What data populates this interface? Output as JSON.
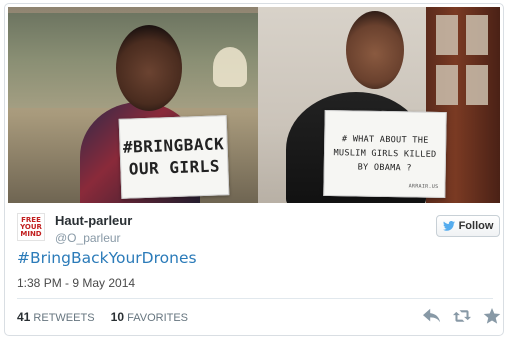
{
  "photo": {
    "sign_left_text": "#BRINGBACK OUR GIRLS",
    "sign_right_text": "# WHAT ABOUT THE MUSLIM GIRLS KILLED BY OBAMA ?",
    "sign_right_credit": "ARRAIR.US"
  },
  "avatar": {
    "line1": "FREE",
    "line2": "YOUR",
    "line3": "MIND"
  },
  "user": {
    "name": "Haut-parleur",
    "handle": "@O_parleur"
  },
  "follow_button": {
    "label": "Follow"
  },
  "tweet": {
    "text": "#BringBackYourDrones",
    "timestamp": "1:38 PM - 9 May 2014"
  },
  "stats": {
    "retweets_count": "41",
    "retweets_label": "RETWEETS",
    "favorites_count": "10",
    "favorites_label": "FAVORITES"
  },
  "colors": {
    "link": "#2b7bb9",
    "twitter_blue": "#55acee",
    "muted": "#8899a6"
  },
  "icons": [
    "reply-icon",
    "retweet-icon",
    "favorite-icon",
    "twitter-bird-icon"
  ]
}
